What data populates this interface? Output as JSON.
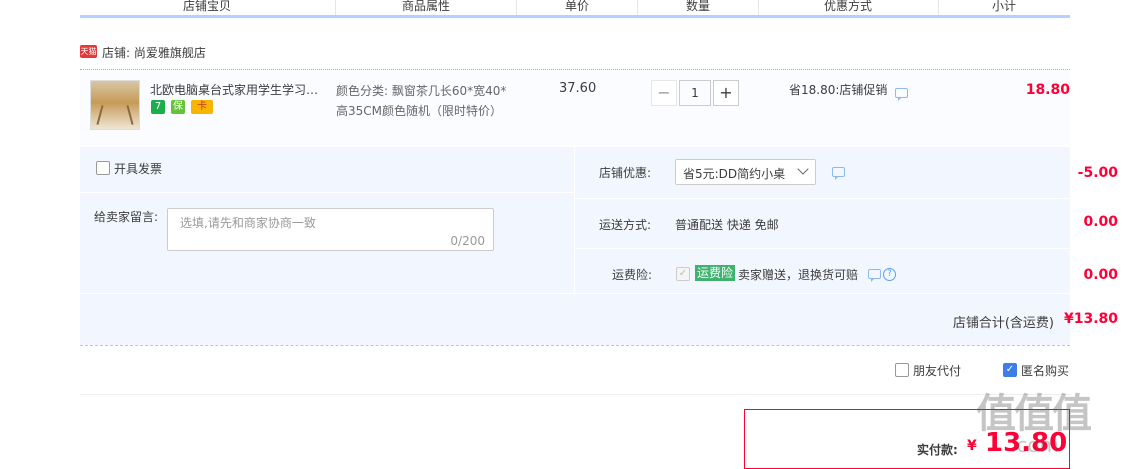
{
  "header": {
    "columns": [
      "店铺宝贝",
      "商品属性",
      "单价",
      "数量",
      "优惠方式",
      "小计"
    ]
  },
  "shop": {
    "badge": "天猫",
    "label": "店铺: 尚爱雅旗舰店"
  },
  "item": {
    "title": "北欧电脑桌台式家用学生学习办公桌",
    "service_icons": [
      "7",
      "保",
      "卡"
    ],
    "property_line1": "颜色分类: 飘窗茶几长60*宽40*",
    "property_line2": "高35CM颜色随机（限时特价）",
    "unit_price": "37.60",
    "quantity": "1",
    "minus": "−",
    "plus": "+",
    "promo": "省18.80:店铺促销",
    "subtotal": "18.80"
  },
  "options": {
    "invoice_label": "开具发票",
    "message_label": "给卖家留言:",
    "message_placeholder": "选填,请先和商家协商一致",
    "message_counter": "0/200",
    "shop_discount_label": "店铺优惠:",
    "shop_discount_value": "省5元:DD简约小桌",
    "shop_discount_amount": "-5.00",
    "shipping_label": "运送方式:",
    "shipping_value": "普通配送 快递 免邮",
    "shipping_amount": "0.00",
    "insurance_label": "运费险:",
    "insurance_badge": "运费险",
    "insurance_text": "卖家赠送，退换货可赔",
    "insurance_amount": "0.00"
  },
  "summary": {
    "label": "店铺合计(含运费)",
    "value": "¥13.80"
  },
  "footer": {
    "friend_pay_label": "朋友代付",
    "anonymous_label": "匿名购买",
    "pay_label": "实付款:",
    "pay_currency": "¥",
    "pay_value": "13.80"
  },
  "watermark": {
    "logo": "值值值",
    "domain": ".com"
  },
  "colors": {
    "accent_red": "#ff0036",
    "accent_blue": "#3e7ce8",
    "panel_bg": "#f2f7ff",
    "insurance_green": "#3fb26f"
  }
}
